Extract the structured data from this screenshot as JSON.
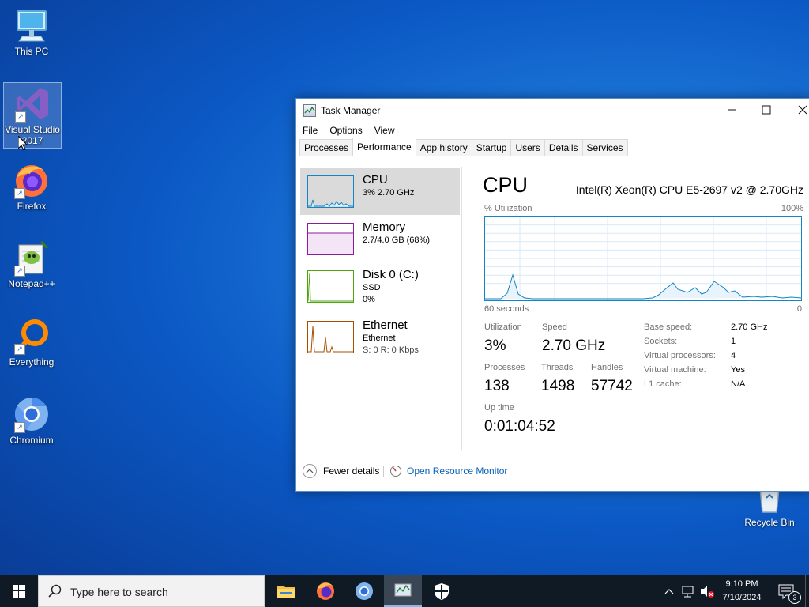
{
  "desktop": {
    "icons": [
      {
        "label": "This PC"
      },
      {
        "label": "Visual Studio 2017"
      },
      {
        "label": "Firefox"
      },
      {
        "label": "Notepad++"
      },
      {
        "label": "Everything"
      },
      {
        "label": "Chromium"
      },
      {
        "label": "Recycle Bin"
      }
    ]
  },
  "window": {
    "title": "Task Manager",
    "menu": [
      "File",
      "Options",
      "View"
    ],
    "tabs": [
      "Processes",
      "Performance",
      "App history",
      "Startup",
      "Users",
      "Details",
      "Services"
    ],
    "active_tab": "Performance"
  },
  "sidebar": {
    "items": [
      {
        "name": "CPU",
        "line1": "3% 2.70 GHz",
        "line2": "",
        "color": "#1185c7"
      },
      {
        "name": "Memory",
        "line1": "2.7/4.0 GB (68%)",
        "line2": "",
        "color": "#8b1c9e"
      },
      {
        "name": "Disk 0 (C:)",
        "line1": "SSD",
        "line2": "0%",
        "color": "#4da60c"
      },
      {
        "name": "Ethernet",
        "line1": "Ethernet",
        "line2": "S: 0 R: 0 Kbps",
        "color": "#a74f01"
      }
    ]
  },
  "detail": {
    "title": "CPU",
    "model": "Intel(R) Xeon(R) CPU E5-2697 v2 @ 2.70GHz",
    "util_label": "% Utilization",
    "util_max": "100%",
    "time_left": "60 seconds",
    "time_right": "0",
    "stats": {
      "utilization_label": "Utilization",
      "utilization": "3%",
      "speed_label": "Speed",
      "speed": "2.70 GHz",
      "processes_label": "Processes",
      "processes": "138",
      "threads_label": "Threads",
      "threads": "1498",
      "handles_label": "Handles",
      "handles": "57742",
      "uptime_label": "Up time",
      "uptime": "0:01:04:52"
    },
    "specs": [
      {
        "k": "Base speed:",
        "v": "2.70 GHz"
      },
      {
        "k": "Sockets:",
        "v": "1"
      },
      {
        "k": "Virtual processors:",
        "v": "4"
      },
      {
        "k": "Virtual machine:",
        "v": "Yes"
      },
      {
        "k": "L1 cache:",
        "v": "N/A"
      }
    ]
  },
  "footer": {
    "fewer_details": "Fewer details",
    "resource_monitor": "Open Resource Monitor"
  },
  "taskbar": {
    "search_placeholder": "Type here to search",
    "time": "9:10 PM",
    "date": "7/10/2024",
    "notification_count": "3"
  },
  "colors": {
    "accent": "#1185c7",
    "link": "#0b62b7"
  }
}
